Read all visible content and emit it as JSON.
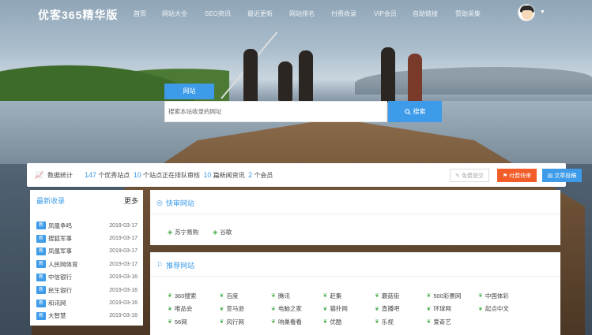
{
  "brand": {
    "logo_text": "优客365精华版"
  },
  "nav": {
    "items": [
      "首页",
      "网站大全",
      "SEO资讯",
      "最近更新",
      "网站排名",
      "付费收录",
      "VIP会员",
      "自助链接",
      "赞助采集"
    ]
  },
  "search": {
    "tab_label": "网站",
    "placeholder": "搜索本站收录的网址",
    "button_label": "搜索"
  },
  "stats": {
    "label": "数据统计",
    "sites_count": "147",
    "sites_text": "个优秀站点",
    "pending_count": "10",
    "pending_text": "个站点正在排队审核",
    "news_count": "10",
    "news_text": "篇新闻资讯",
    "members_count": "2",
    "members_text": "个会员",
    "free_submit": "免费提交",
    "paid_submit": "付费快审",
    "article_submit": "文章投稿"
  },
  "recent": {
    "title": "最新收录",
    "more": "更多",
    "badge": "新",
    "items": [
      {
        "name": "凤凰争鸣",
        "date": "2019-03-17"
      },
      {
        "name": "搜狐军事",
        "date": "2019-03-17"
      },
      {
        "name": "凤凰军事",
        "date": "2019-03-17"
      },
      {
        "name": "人民网体育",
        "date": "2019-03-17"
      },
      {
        "name": "中信银行",
        "date": "2019-03-16"
      },
      {
        "name": "民生银行",
        "date": "2019-03-16"
      },
      {
        "name": "和讯网",
        "date": "2019-03-16"
      },
      {
        "name": "大智慧",
        "date": "2019-03-16"
      }
    ]
  },
  "quick": {
    "title": "快审网站",
    "links": [
      "苏宁易购",
      "谷歌"
    ]
  },
  "recommend": {
    "title": "推荐网站",
    "rows": [
      [
        "360搜索",
        "百度",
        "腾讯",
        "赶集",
        "蘑菇街",
        "500彩票网",
        "中国体彩"
      ],
      [
        "唯品会",
        "亚马逊",
        "电脑之家",
        "猫扑网",
        "直播吧",
        "环球网",
        "起点中文"
      ],
      [
        "56网",
        "风行网",
        "响巢看看",
        "优酷",
        "乐视",
        "爱奇艺",
        ""
      ]
    ]
  }
}
